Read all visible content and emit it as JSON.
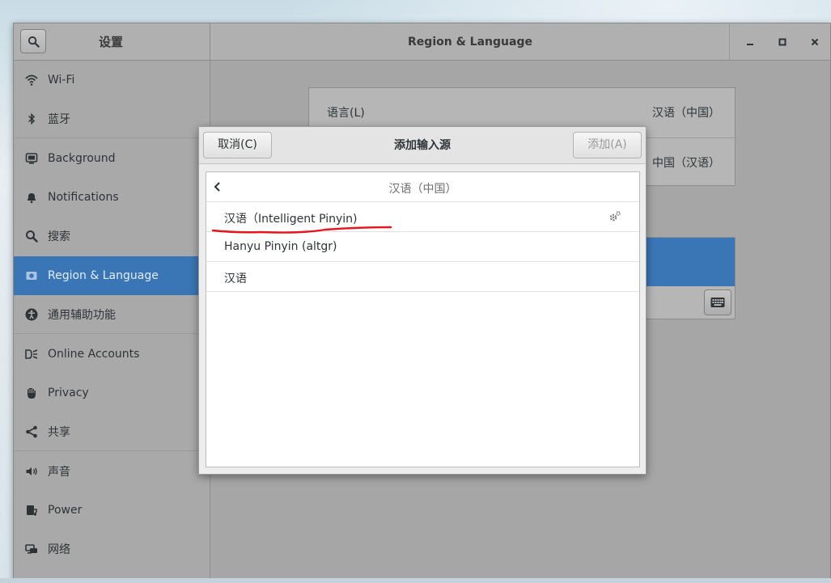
{
  "window": {
    "sidebar_title": "设置",
    "main_title": "Region & Language"
  },
  "sidebar": {
    "items": [
      {
        "label": "Wi-Fi",
        "icon": "wifi-icon"
      },
      {
        "label": "蓝牙",
        "icon": "bluetooth-icon"
      },
      {
        "label": "Background",
        "icon": "background-icon"
      },
      {
        "label": "Notifications",
        "icon": "bell-icon"
      },
      {
        "label": "搜索",
        "icon": "search-icon"
      },
      {
        "label": "Region & Language",
        "icon": "region-icon",
        "active": true
      },
      {
        "label": "通用辅助功能",
        "icon": "accessibility-icon"
      },
      {
        "label": "Online Accounts",
        "icon": "online-accounts-icon"
      },
      {
        "label": "Privacy",
        "icon": "hand-icon"
      },
      {
        "label": "共享",
        "icon": "share-icon"
      },
      {
        "label": "声音",
        "icon": "speaker-icon"
      },
      {
        "label": "Power",
        "icon": "power-icon"
      },
      {
        "label": "网络",
        "icon": "network-icon"
      }
    ]
  },
  "region": {
    "language_label": "语言(L)",
    "language_value": "汉语（中国）",
    "formats_value": "中国（汉语）"
  },
  "dialog": {
    "title": "添加输入源",
    "cancel_label": "取消(C)",
    "add_label": "添加(A)",
    "back_title": "汉语（中国）",
    "sources": [
      {
        "label": "汉语（Intelligent Pinyin)",
        "has_settings": true
      },
      {
        "label": "Hanyu Pinyin (altgr)",
        "has_settings": false
      },
      {
        "label": "汉语",
        "has_settings": false
      }
    ]
  },
  "colors": {
    "accent": "#3a76b6",
    "annotation": "#e8141b"
  }
}
